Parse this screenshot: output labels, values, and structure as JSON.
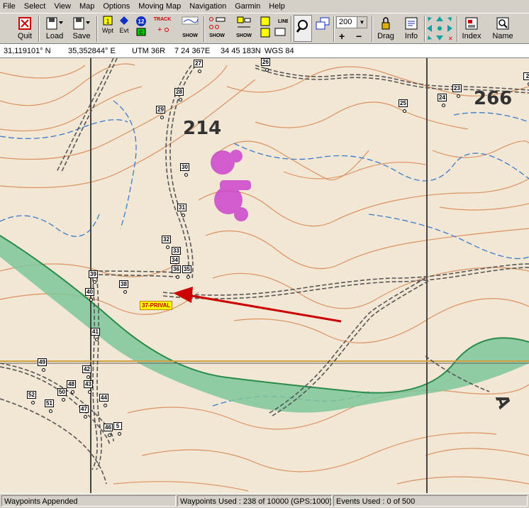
{
  "menu": [
    "File",
    "Select",
    "View",
    "Map",
    "Options",
    "Moving Map",
    "Navigation",
    "Garmin",
    "Help"
  ],
  "toolbar": {
    "quit": "Quit",
    "load": "Load",
    "save": "Save",
    "wpt": "Wpt",
    "evt": "Evt",
    "badge_num": "12",
    "track": "TRACK",
    "show": "SHOW",
    "line": "LINE",
    "zoom_value": "200",
    "drag": "Drag",
    "info": "Info",
    "index": "Index",
    "name": "Name",
    "icons": [
      "quit-icon",
      "load-icon",
      "save-icon",
      "waypoint-icon",
      "event-icon",
      "track-icon",
      "route-icon",
      "line-icon",
      "zoom-icon",
      "drag-icon",
      "info-icon",
      "pan-arrows-icon",
      "index-icon",
      "name-icon"
    ]
  },
  "coords": {
    "lat": "31,119101° N",
    "lon": "35,352844° E",
    "utm": "UTM  36R",
    "easting": "7 24 367E",
    "northing": "34 45 183N",
    "datum": "WGS 84"
  },
  "map": {
    "elevation_labels": [
      "214",
      "266",
      "A"
    ],
    "highlight_label": "37-PRIVAL",
    "colors": {
      "background": "#f2e6d4",
      "contour": "#d98a55",
      "water": "#3a7ccc",
      "road": "#555555",
      "grid": "#444444",
      "green_band": "#7fc79a",
      "purple": "#cc44cc",
      "arrow": "#cc0000",
      "highlight": "#ffff00"
    },
    "waypoints": [
      {
        "n": "27"
      },
      {
        "n": "26"
      },
      {
        "n": "23"
      },
      {
        "n": "24"
      },
      {
        "n": "25"
      },
      {
        "n": "28"
      },
      {
        "n": "29"
      },
      {
        "n": "30"
      },
      {
        "n": "31"
      },
      {
        "n": "32"
      },
      {
        "n": "33"
      },
      {
        "n": "34"
      },
      {
        "n": "36"
      },
      {
        "n": "35"
      },
      {
        "n": "39"
      },
      {
        "n": "38"
      },
      {
        "n": "40"
      },
      {
        "n": "41"
      },
      {
        "n": "49"
      },
      {
        "n": "42"
      },
      {
        "n": "48"
      },
      {
        "n": "43"
      },
      {
        "n": "50"
      },
      {
        "n": "52"
      },
      {
        "n": "44"
      },
      {
        "n": "51"
      },
      {
        "n": "47"
      },
      {
        "n": "46"
      },
      {
        "n": "5"
      },
      {
        "n": "2"
      }
    ]
  },
  "status": {
    "message": "Waypoints Appended",
    "waypoints_used": "Waypoints Used : 238 of 10000  (GPS:1000)",
    "events_used": "Events Used : 0 of 500"
  }
}
